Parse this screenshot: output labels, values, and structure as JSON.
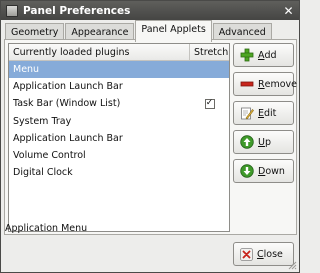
{
  "window": {
    "title": "Panel Preferences"
  },
  "tabs": [
    {
      "label": "Geometry"
    },
    {
      "label": "Appearance"
    },
    {
      "label": "Panel Applets"
    },
    {
      "label": "Advanced"
    }
  ],
  "active_tab": "Panel Applets",
  "plugins": {
    "columns": {
      "name": "Currently loaded plugins",
      "stretch": "Stretch"
    },
    "rows": [
      {
        "name": "Menu",
        "stretch": false,
        "selected": true
      },
      {
        "name": "Application Launch Bar",
        "stretch": false
      },
      {
        "name": "Task Bar (Window List)",
        "stretch": true
      },
      {
        "name": "System Tray",
        "stretch": false
      },
      {
        "name": "Application Launch Bar",
        "stretch": false
      },
      {
        "name": "Volume Control",
        "stretch": false
      },
      {
        "name": "Digital Clock",
        "stretch": false
      }
    ],
    "description": "Application Menu"
  },
  "buttons": {
    "add": {
      "mnemonic": "A",
      "rest": "dd"
    },
    "remove": {
      "mnemonic": "R",
      "rest": "emove"
    },
    "edit": {
      "mnemonic": "E",
      "rest": "dit"
    },
    "up": {
      "mnemonic": "U",
      "rest": "p"
    },
    "down": {
      "mnemonic": "D",
      "rest": "own"
    },
    "close": {
      "mnemonic": "C",
      "rest": "lose"
    }
  },
  "colors": {
    "selection": "#86abd9",
    "add": "#4ea524",
    "remove": "#c8251c",
    "up_down": "#3f9a2a"
  }
}
